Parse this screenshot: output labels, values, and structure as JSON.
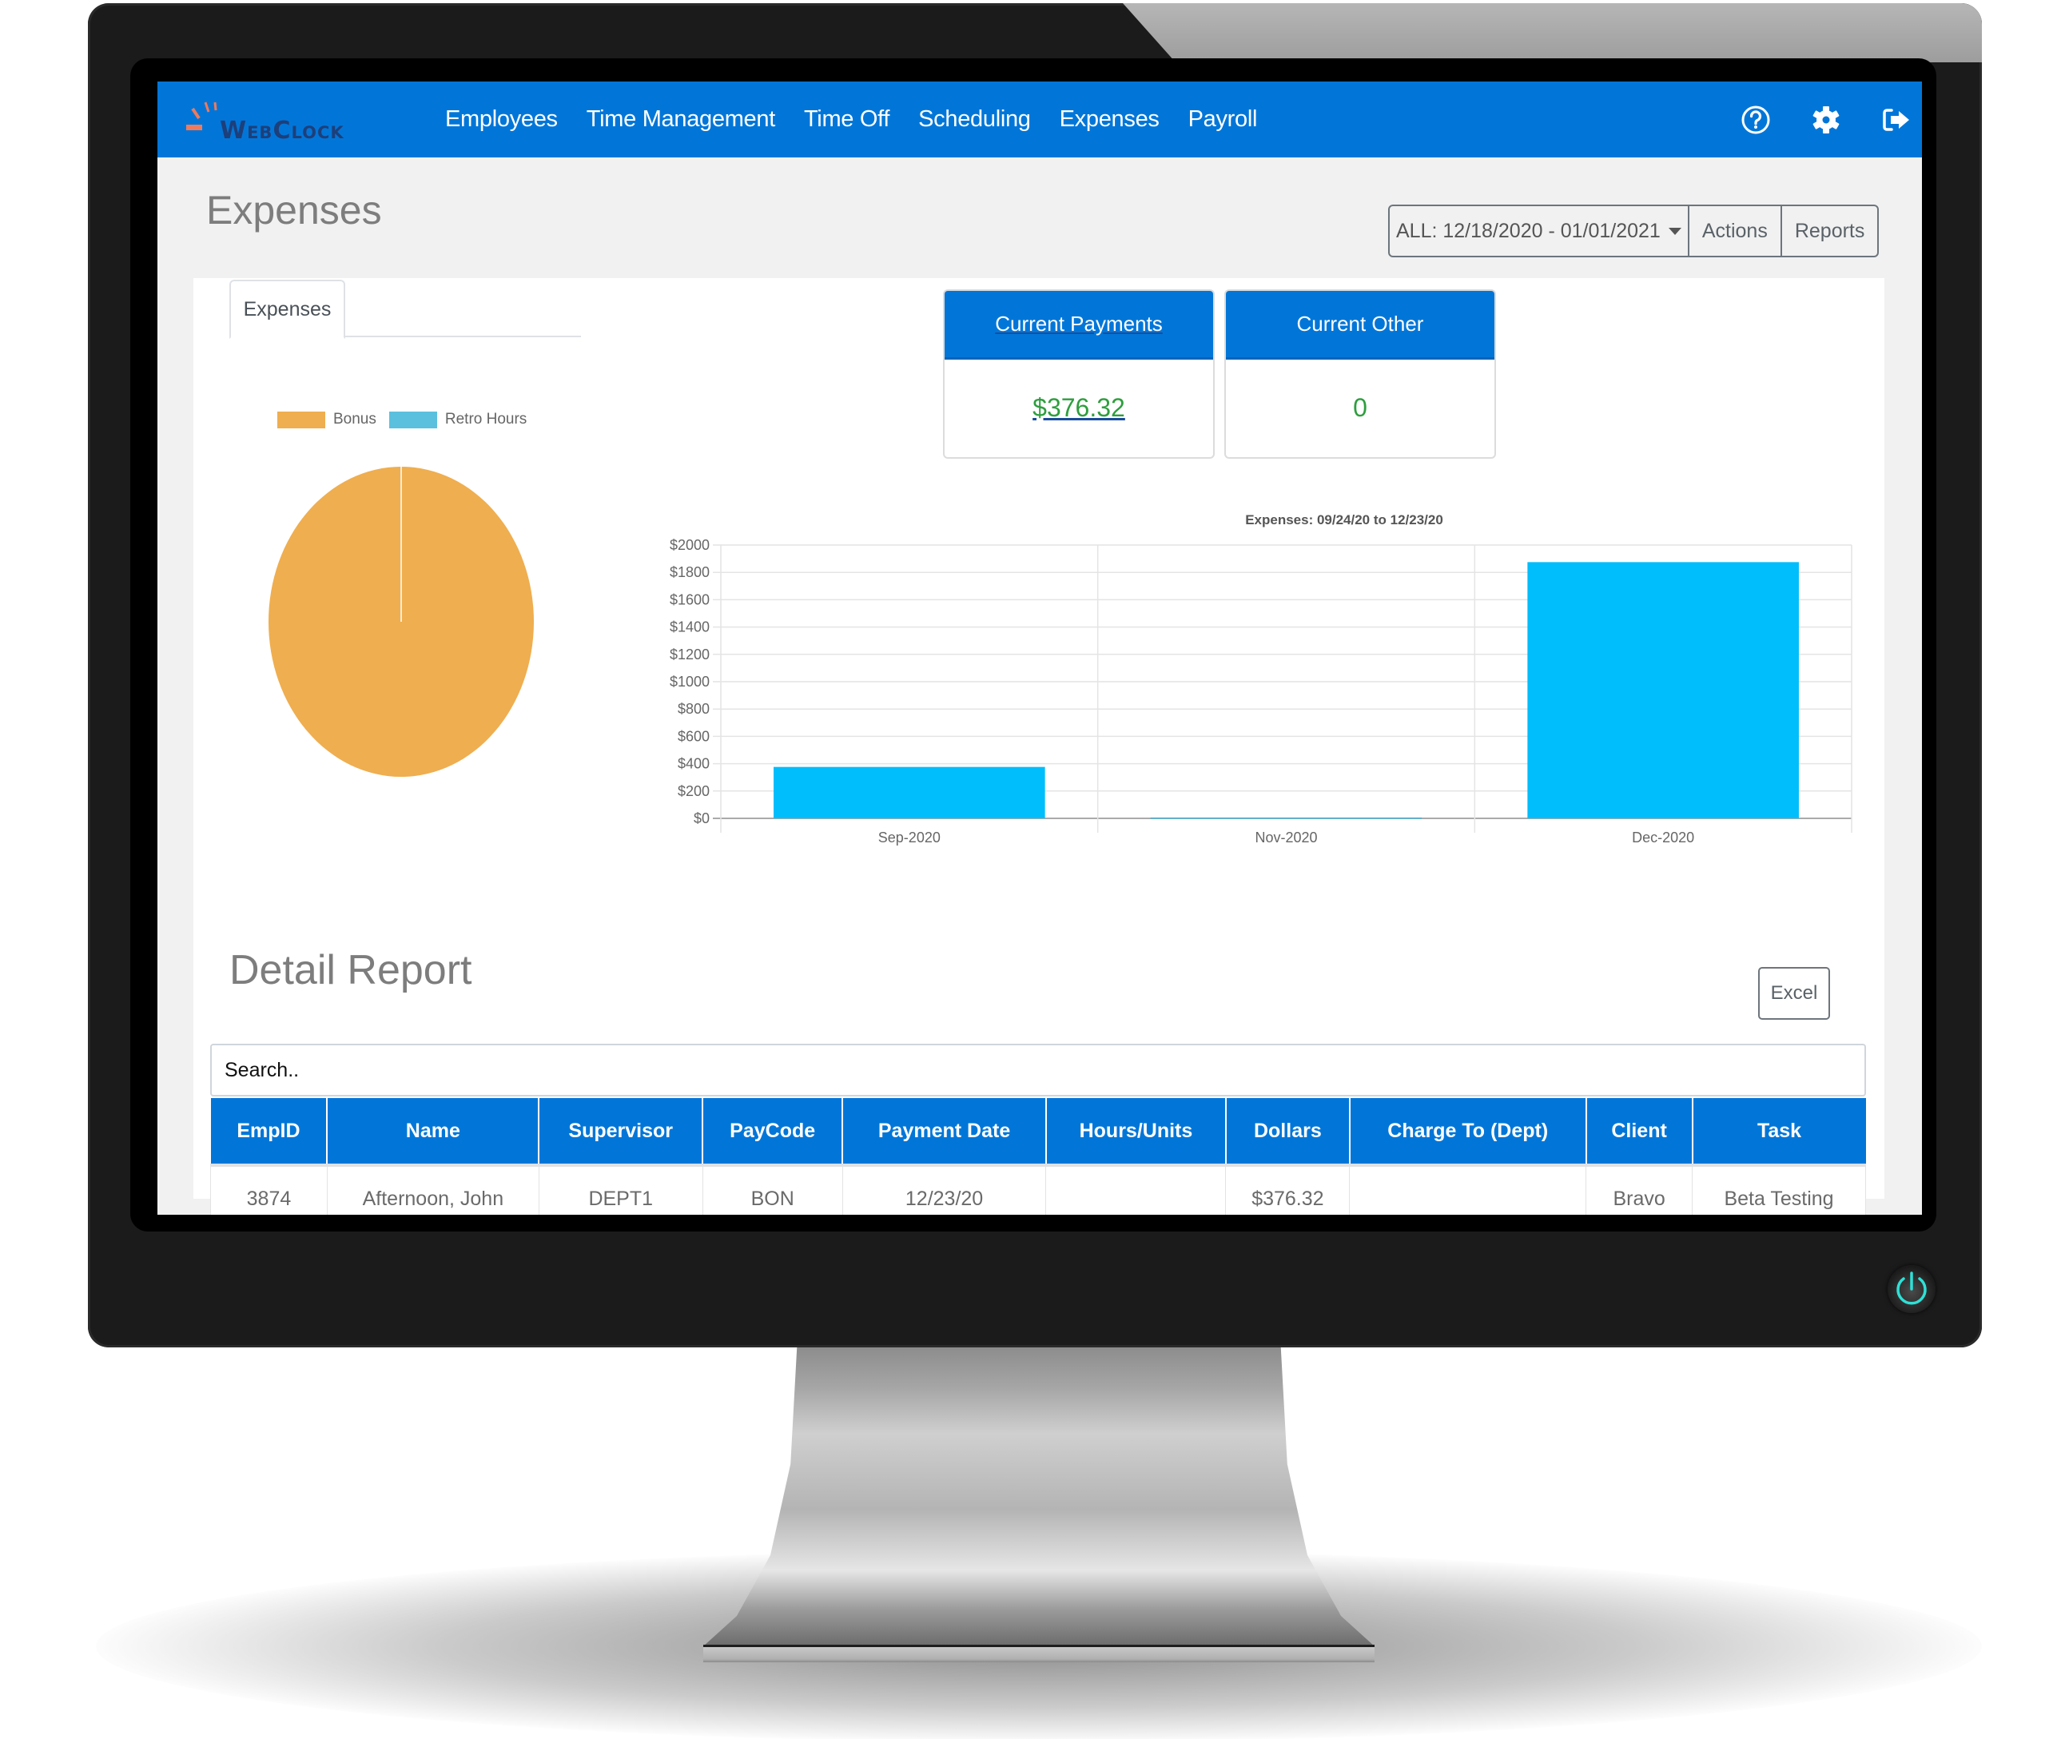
{
  "app": {
    "logo_text": "WebClock",
    "brand_color": "#0276d8"
  },
  "nav": {
    "items": [
      {
        "label": "Employees"
      },
      {
        "label": "Time Management"
      },
      {
        "label": "Time Off"
      },
      {
        "label": "Scheduling"
      },
      {
        "label": "Expenses"
      },
      {
        "label": "Payroll"
      }
    ],
    "icons": [
      "help-icon",
      "gear-icon",
      "logout-icon"
    ]
  },
  "page": {
    "title": "Expenses",
    "date_range": "ALL: 12/18/2020 - 01/01/2021",
    "actions_label": "Actions",
    "reports_label": "Reports"
  },
  "tabs": [
    {
      "label": "Expenses",
      "active": true
    }
  ],
  "kpis": [
    {
      "title": "Current Payments",
      "value": "$376.32",
      "value_color": "#2e9e3e"
    },
    {
      "title": "Current Other",
      "value": "0",
      "value_color": "#2e9e3e"
    }
  ],
  "chart_data": [
    {
      "type": "pie",
      "title": "",
      "legend": "top",
      "categories": [
        "Bonus",
        "Retro Hours"
      ],
      "values": [
        376.32,
        0
      ],
      "colors": [
        "#efae4f",
        "#5bc0de"
      ]
    },
    {
      "type": "bar",
      "title": "Expenses: 09/24/20 to 12/23/20",
      "categories": [
        "Sep-2020",
        "Nov-2020",
        "Dec-2020"
      ],
      "values": [
        376.32,
        5,
        1875
      ],
      "xlabel": "",
      "ylabel": "",
      "ylim": [
        0,
        2000
      ],
      "yticks": [
        0,
        200,
        400,
        600,
        800,
        1000,
        1200,
        1400,
        1600,
        1800,
        2000
      ],
      "ytick_labels": [
        "$0",
        "$200",
        "$400",
        "$600",
        "$800",
        "$1000",
        "$1200",
        "$1400",
        "$1600",
        "$1800",
        "$2000"
      ],
      "grid": true,
      "bar_color": "#00bdfb"
    }
  ],
  "detail": {
    "title": "Detail Report",
    "excel_label": "Excel",
    "search_placeholder": "Search..",
    "columns": [
      "EmpID",
      "Name",
      "Supervisor",
      "PayCode",
      "Payment Date",
      "Hours/Units",
      "Dollars",
      "Charge To (Dept)",
      "Client",
      "Task"
    ],
    "rows": [
      [
        "3874",
        "Afternoon, John",
        "DEPT1",
        "BON",
        "12/23/20",
        "",
        "$376.32",
        "",
        "Bravo",
        "Beta Testing"
      ]
    ]
  }
}
